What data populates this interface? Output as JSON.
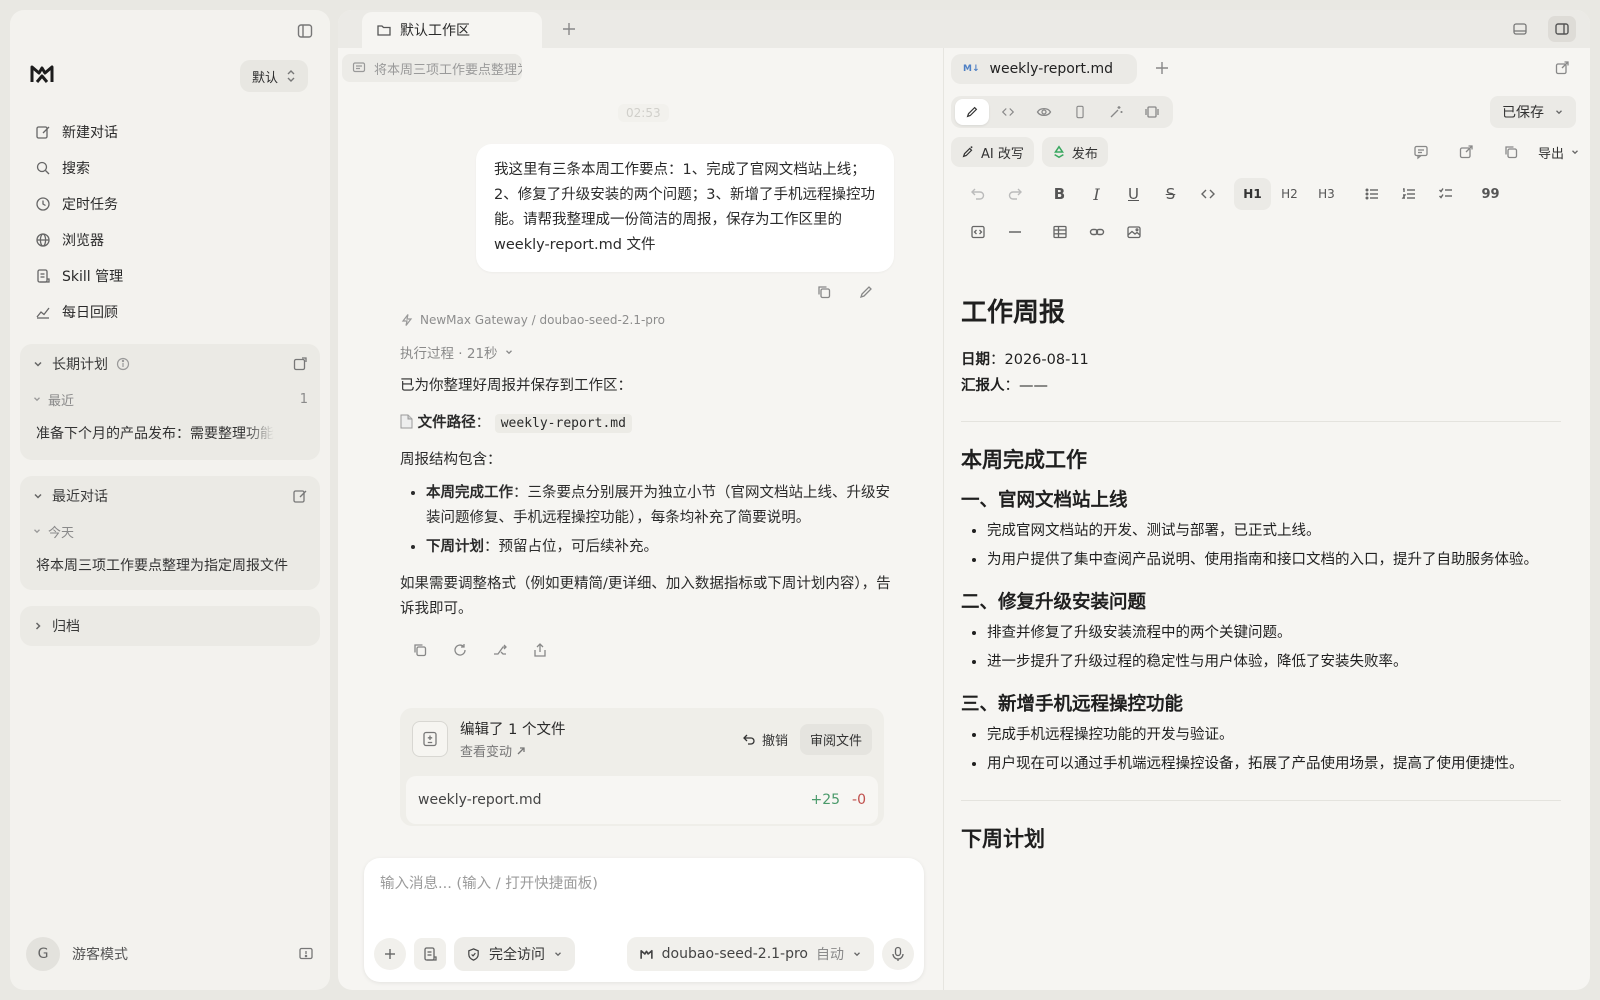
{
  "sidebar": {
    "workspace": "默认",
    "nav": [
      {
        "label": "新建对话",
        "icon": "edit-icon"
      },
      {
        "label": "搜索",
        "icon": "search-icon"
      },
      {
        "label": "定时任务",
        "icon": "clock-icon"
      },
      {
        "label": "浏览器",
        "icon": "globe-icon"
      },
      {
        "label": "Skill 管理",
        "icon": "skill-icon"
      },
      {
        "label": "每日回顾",
        "icon": "chart-icon"
      }
    ],
    "long_term": {
      "title": "长期计划",
      "recent_label": "最近",
      "recent_count": "1",
      "item": "准备下个月的产品发布：需要整理功能"
    },
    "recent_convs": {
      "title": "最近对话",
      "today_label": "今天",
      "item": "将本周三项工作要点整理为指定周报文件"
    },
    "archive": "归档",
    "user": {
      "initial": "G",
      "label": "游客模式"
    }
  },
  "tabs": {
    "active": "默认工作区"
  },
  "chat": {
    "conv_title": "将本周三项工作要点整理为指定周报文件",
    "timestamp": "02:53",
    "user_message": "我这里有三条本周工作要点：1、完成了官网文档站上线；2、修复了升级安装的两个问题；3、新增了手机远程操控功能。请帮我整理成一份简洁的周报，保存为工作区里的 weekly-report.md 文件",
    "gateway": "NewMax Gateway / doubao-seed-2.1-pro",
    "exec": "执行过程 · 21秒",
    "reply_intro": "已为你整理好周报并保存到工作区：",
    "path_label": "文件路径",
    "path_colon": "：",
    "path_value": "weekly-report.md",
    "structure_intro": "周报结构包含：",
    "bullet1_bold": "本周完成工作",
    "bullet1_text": "：三条要点分别展开为独立小节（官网文档站上线、升级安装问题修复、手机远程操控功能），每条均补充了简要说明。",
    "bullet2_bold": "下周计划",
    "bullet2_text": "：预留占位，可后续补充。",
    "closing": "如果需要调整格式（例如更精简/更详细、加入数据指标或下周计划内容），告诉我即可。",
    "edit_card": {
      "title": "编辑了 1 个文件",
      "view_changes": "查看变动",
      "undo": "撤销",
      "review": "审阅文件",
      "file": "weekly-report.md",
      "added": "+25",
      "removed": "-0"
    },
    "input": {
      "placeholder": "输入消息... (输入 / 打开快捷面板)",
      "permission": "完全访问",
      "model": "doubao-seed-2.1-pro",
      "model_mode": "自动"
    }
  },
  "editor": {
    "file_badge": "M↓",
    "file_tab": "weekly-report.md",
    "saved": "已保存",
    "ai_rewrite": "AI 改写",
    "publish": "发布",
    "export": "导出",
    "headings": [
      "H1",
      "H2",
      "H3"
    ],
    "quote": "99",
    "doc": {
      "title": "工作周报",
      "date_label": "日期",
      "date_value": "2026-08-11",
      "reporter_label": "汇报人",
      "reporter_value": "——",
      "colon": "：",
      "section1": "本周完成工作",
      "sub1": "一、官网文档站上线",
      "sub1_items": [
        "完成官网文档站的开发、测试与部署，已正式上线。",
        "为用户提供了集中查阅产品说明、使用指南和接口文档的入口，提升了自助服务体验。"
      ],
      "sub2": "二、修复升级安装问题",
      "sub2_items": [
        "排查并修复了升级安装流程中的两个关键问题。",
        "进一步提升了升级过程的稳定性与用户体验，降低了安装失败率。"
      ],
      "sub3": "三、新增手机远程操控功能",
      "sub3_items": [
        "完成手机远程操控功能的开发与验证。",
        "用户现在可以通过手机端远程操控设备，拓展了产品使用场景，提高了使用便捷性。"
      ],
      "section2": "下周计划"
    }
  }
}
